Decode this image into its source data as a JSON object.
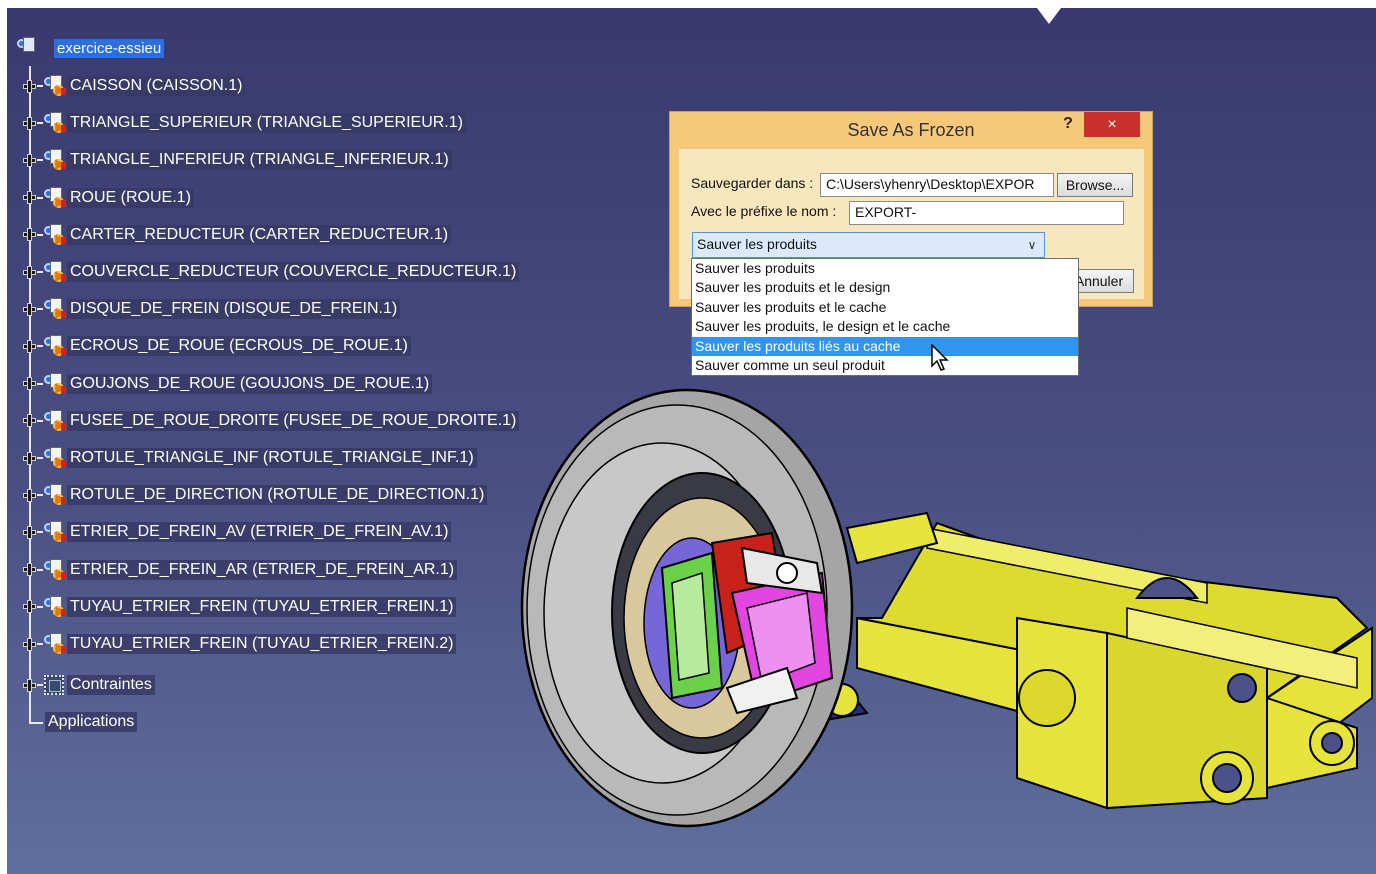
{
  "tree": {
    "root_label": "exercice-essieu",
    "items": [
      {
        "label": "CAISSON (CAISSON.1)"
      },
      {
        "label": "TRIANGLE_SUPERIEUR (TRIANGLE_SUPERIEUR.1)"
      },
      {
        "label": "TRIANGLE_INFERIEUR (TRIANGLE_INFERIEUR.1)"
      },
      {
        "label": "ROUE (ROUE.1)"
      },
      {
        "label": "CARTER_REDUCTEUR (CARTER_REDUCTEUR.1)"
      },
      {
        "label": "COUVERCLE_REDUCTEUR (COUVERCLE_REDUCTEUR.1)"
      },
      {
        "label": "DISQUE_DE_FREIN (DISQUE_DE_FREIN.1)"
      },
      {
        "label": "ECROUS_DE_ROUE (ECROUS_DE_ROUE.1)"
      },
      {
        "label": "GOUJONS_DE_ROUE (GOUJONS_DE_ROUE.1)"
      },
      {
        "label": "FUSEE_DE_ROUE_DROITE (FUSEE_DE_ROUE_DROITE.1)"
      },
      {
        "label": "ROTULE_TRIANGLE_INF (ROTULE_TRIANGLE_INF.1)"
      },
      {
        "label": "ROTULE_DE_DIRECTION (ROTULE_DE_DIRECTION.1)"
      },
      {
        "label": "ETRIER_DE_FREIN_AV (ETRIER_DE_FREIN_AV.1)"
      },
      {
        "label": "ETRIER_DE_FREIN_AR (ETRIER_DE_FREIN_AR.1)"
      },
      {
        "label": "TUYAU_ETRIER_FREIN (TUYAU_ETRIER_FREIN.1)"
      },
      {
        "label": "TUYAU_ETRIER_FREIN (TUYAU_ETRIER_FREIN.2)"
      }
    ],
    "constraints_label": "Contraintes",
    "applications_label": "Applications"
  },
  "dialog": {
    "title": "Save As Frozen",
    "help_label": "?",
    "close_label": "×",
    "save_in_label": "Sauvegarder dans :",
    "save_in_value": "C:\\Users\\yhenry\\Desktop\\EXPOR",
    "browse_label": "Browse...",
    "prefix_label": "Avec le préfixe le nom :",
    "prefix_value": "EXPORT-",
    "mode_selected": "Sauver les produits",
    "cancel_label": "Annuler",
    "mode_options": [
      "Sauver les produits",
      "Sauver les produits et le design",
      "Sauver les produits et le cache",
      "Sauver les produits, le design et le cache",
      "Sauver les produits liés au cache",
      "Sauver comme un seul produit"
    ],
    "highlighted_option": "Sauver les produits liés au cache"
  },
  "colors": {
    "background_top": "#39396f",
    "background_bottom": "#5f6f9e",
    "selection": "#2b6ee0",
    "dialog_bg": "#f8e6bd",
    "close_button": "#c9302c",
    "highlight": "#3394f0",
    "chassis_yellow": "#e6e33a",
    "tire_grey": "#a5a5a5"
  },
  "icons": {
    "part": "part-icon",
    "product_root": "product-icon",
    "constraints": "constraints-icon",
    "cursor": "mouse-pointer-icon"
  }
}
